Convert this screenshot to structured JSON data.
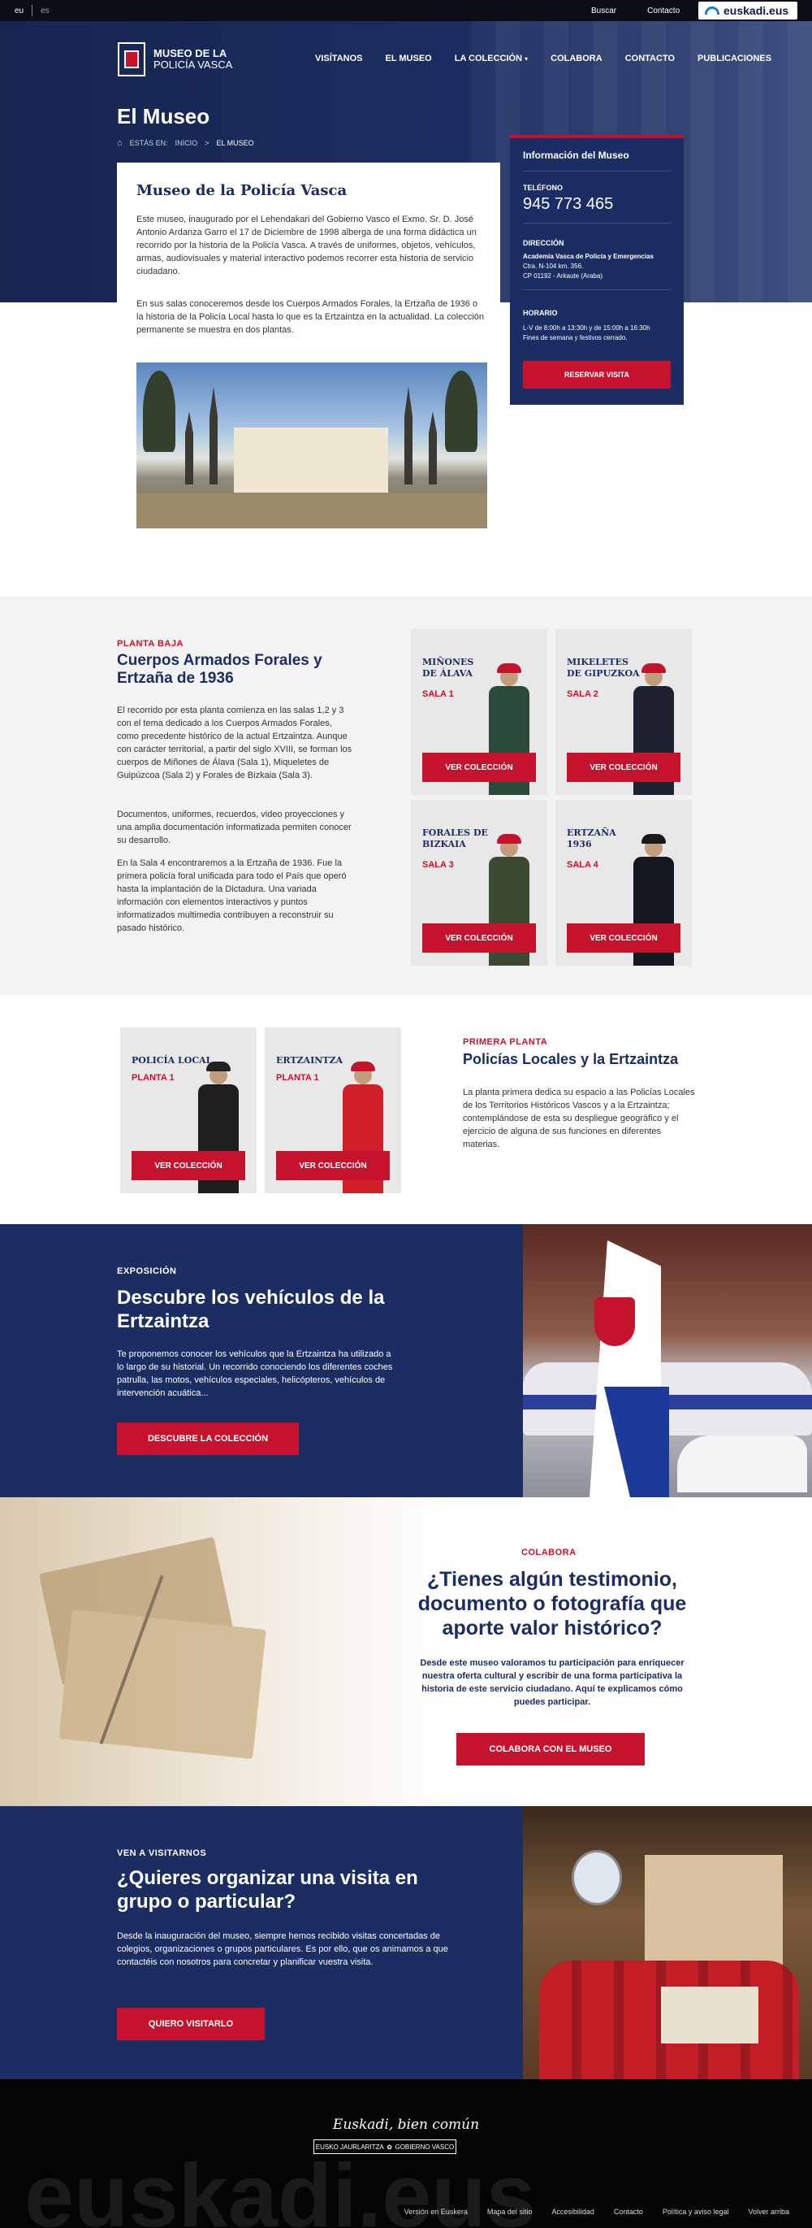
{
  "topbar": {
    "lang_eu": "eu",
    "lang_es": "es",
    "buscar": "Buscar",
    "contacto": "Contacto",
    "euskadi_logo": "euskadi.eus"
  },
  "header": {
    "logo_line1": "MUSEO DE LA",
    "logo_line2": "POLICÍA VASCA",
    "nav": [
      "VISÍTANOS",
      "EL MUSEO",
      "LA COLECCIÓN",
      "COLABORA",
      "CONTACTO",
      "PUBLICACIONES"
    ]
  },
  "hero": {
    "title": "El Museo",
    "breadcrumb_label": "ESTÁS EN:",
    "breadcrumb_home": "INICIO",
    "breadcrumb_sep": ">",
    "breadcrumb_current": "EL MUSEO"
  },
  "intro": {
    "title": "Museo de la Policía Vasca",
    "p1": "Este museo, inaugurado por el Lehendakari del Gobierno Vasco el Exmo. Sr. D. José Antonio Ardanza Garro el 17 de Diciembre de 1998 alberga de una forma didáctica un recorrido por la historia de la Policía Vasca. A través de uniformes, objetos, vehículos, armas, audiovisuales y material interactivo podemos recorrer esta historia de servicio ciudadano.",
    "p2": "En sus salas conoceremos desde los Cuerpos Armados Forales, la Ertzaña de 1936 o la historia de la Policía Local hasta lo que es la Ertzaintza en la actualidad. La colección permanente se muestra en dos plantas."
  },
  "info": {
    "title": "Información del Museo",
    "tel_label": "TELÉFONO",
    "phone": "945 773 465",
    "dir_label": "DIRECCIÓN",
    "dir_line1": "Academia Vasca de Policía y Emergencias",
    "dir_line2": "Ctra. N-104 km. 356.",
    "dir_line3": "CP 01192 - Arkaute (Araba)",
    "hor_label": "HORARIO",
    "hor_line1": "L-V de 8:00h a 13:30h y de 15:00h a 16:30h",
    "hor_line2": "Fines de semana y festivos cerrado.",
    "btn": "RESERVAR VISITA"
  },
  "planta_baja": {
    "eyebrow": "PLANTA BAJA",
    "title": "Cuerpos Armados Forales y Ertzaña de 1936",
    "p1": "El recorrido por esta planta comienza en las salas 1,2 y 3 con el tema dedicado a los Cuerpos Armados Forales, como precedente histórico de la actual Ertzaintza. Aunque con carácter territorial, a partir del siglo XVIII, se forman los cuerpos de Miñones de Álava (Sala 1), Miqueletes de Guipúzcoa (Sala 2) y Forales de Bizkaia (Sala 3).",
    "p2": "Documentos, uniformes, recuerdos, video proyecciones y una amplia documentación informatizada permiten conocer su desarrollo.",
    "p3": "En la Sala 4 encontraremos a la Ertzaña de 1936. Fue la primera policía foral unificada para todo el País que operó hasta la implantación de la Dictadura. Una variada información con elementos interactivos y puntos informatizados multimedia contribuyen a reconstruir su pasado histórico.",
    "cards": [
      {
        "name1": "MIÑONES",
        "name2": "DE ÁLAVA",
        "sala": "SALA 1",
        "btn": "VER COLECCIÓN"
      },
      {
        "name1": "MIKELETES",
        "name2": "DE GIPUZKOA",
        "sala": "SALA 2",
        "btn": "VER COLECCIÓN"
      },
      {
        "name1": "FORALES DE",
        "name2": "BIZKAIA",
        "sala": "SALA 3",
        "btn": "VER COLECCIÓN"
      },
      {
        "name1": "ERTZAÑA",
        "name2": "1936",
        "sala": "SALA 4",
        "btn": "VER COLECCIÓN"
      }
    ]
  },
  "primera_planta": {
    "eyebrow": "PRIMERA PLANTA",
    "title": "Policías Locales y la Ertzaintza",
    "text": "La planta primera dedica su espacio a las Policías Locales de los Territorios Históricos Vascos y a la Ertzaintza; contemplándose de esta su despliegue geográfico y el ejercicio de alguna de sus funciones en diferentes materias.",
    "cards": [
      {
        "name1": "POLICÍA LOCAL",
        "sala": "PLANTA 1",
        "btn": "VER COLECCIÓN"
      },
      {
        "name1": "ERTZAINTZA",
        "sala": "PLANTA 1",
        "btn": "VER COLECCIÓN"
      }
    ]
  },
  "vehiculos": {
    "eyebrow": "EXPOSICIÓN",
    "title": "Descubre los vehículos de la Ertzaintza",
    "text": "Te proponemos conocer los vehículos que la Ertzaintza ha utilizado a lo largo de su historial. Un recorrido conociendo los diferentes coches patrulla, las motos, vehículos especiales, helicópteros, vehículos de intervención acuática...",
    "btn": "DESCUBRE LA COLECCIÓN"
  },
  "colabora": {
    "eyebrow": "COLABORA",
    "title": "¿Tienes algún testimonio, documento o fotografía que aporte valor histórico?",
    "text": "Desde este museo valoramos tu participación para enriquecer nuestra oferta cultural y escribir de una forma participativa la historia de este servicio ciudadano. Aquí te explicamos cómo puedes participar.",
    "btn": "COLABORA CON EL MUSEO"
  },
  "visitanos": {
    "eyebrow": "VEN A VISITARNOS",
    "title": "¿Quieres organizar una visita en grupo o particular?",
    "text": "Desde la inauguración del museo, siempre hemos recibido visitas concertadas de colegios, organizaciones o grupos particulares. Es por ello, que os animamos a que contactéis con nosotros para concretar y planificar vuestra visita.",
    "btn": "QUIERO VISITARLO"
  },
  "footer": {
    "tagline": "Euskadi, bien común",
    "gov_left": "EUSKO JAURLARITZA",
    "gov_right": "GOBIERNO VASCO",
    "big": "euskadi.eus",
    "links": [
      "Versión en Euskera",
      "Mapa del sitio",
      "Accesibilidad",
      "Contacto",
      "Política y aviso legal",
      "Volver arriba"
    ]
  },
  "colors": {
    "navy": "#1b2d62",
    "red": "#c5132e",
    "gray_bg": "#f3f3f3"
  }
}
